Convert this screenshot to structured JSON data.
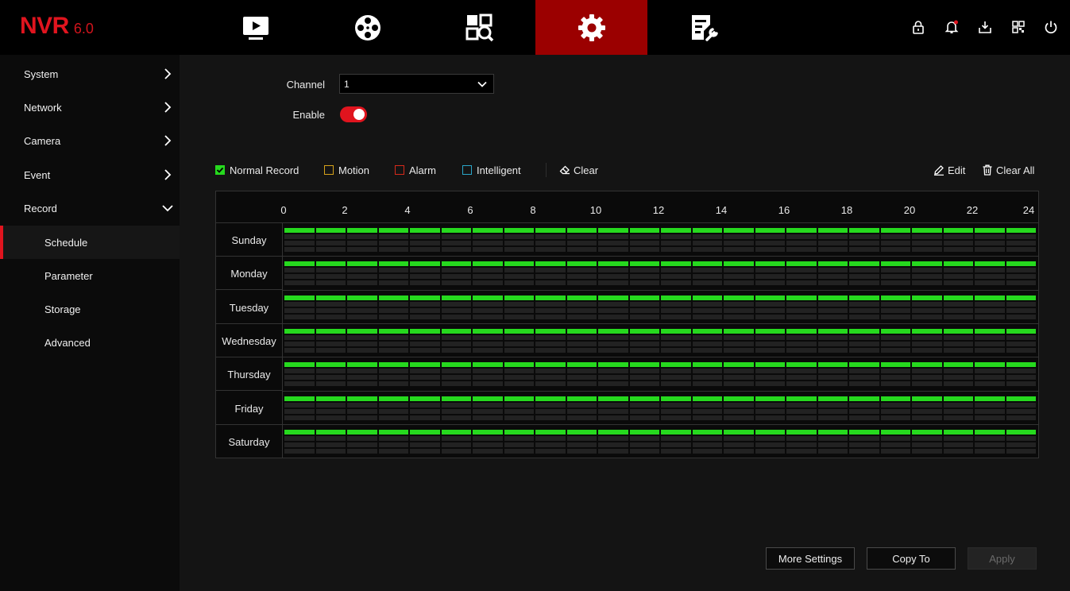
{
  "logo": {
    "main": "NVR",
    "version": "6.0"
  },
  "nav_tabs": [
    {
      "name": "playback-icon",
      "active": false
    },
    {
      "name": "film-reel-icon",
      "active": false
    },
    {
      "name": "search-grid-icon",
      "active": false
    },
    {
      "name": "gear-icon",
      "active": true
    },
    {
      "name": "maintenance-icon",
      "active": false
    }
  ],
  "top_icons": [
    "lock-icon",
    "bell-icon",
    "download-icon",
    "qr-code-icon",
    "power-icon"
  ],
  "sidebar": {
    "items": [
      {
        "label": "System",
        "expanded": false
      },
      {
        "label": "Network",
        "expanded": false
      },
      {
        "label": "Camera",
        "expanded": false
      },
      {
        "label": "Event",
        "expanded": false
      },
      {
        "label": "Record",
        "expanded": true
      }
    ],
    "sub_items": [
      {
        "label": "Schedule",
        "active": true
      },
      {
        "label": "Parameter",
        "active": false
      },
      {
        "label": "Storage",
        "active": false
      },
      {
        "label": "Advanced",
        "active": false
      }
    ]
  },
  "form": {
    "channel_label": "Channel",
    "channel_value": "1",
    "enable_label": "Enable",
    "enable_on": true
  },
  "legend": [
    {
      "label": "Normal Record",
      "color": "#26d91e",
      "checked": true
    },
    {
      "label": "Motion",
      "color": "#d6a21a",
      "checked": false
    },
    {
      "label": "Alarm",
      "color": "#d62a1a",
      "checked": false
    },
    {
      "label": "Intelligent",
      "color": "#2aa6c8",
      "checked": false
    }
  ],
  "tools": {
    "clear": "Clear",
    "edit": "Edit",
    "clear_all": "Clear All"
  },
  "schedule": {
    "hour_labels": [
      "0",
      "2",
      "4",
      "6",
      "8",
      "10",
      "12",
      "14",
      "16",
      "18",
      "20",
      "22",
      "24"
    ],
    "days": [
      "Sunday",
      "Monday",
      "Tuesday",
      "Wednesday",
      "Thursday",
      "Friday",
      "Saturday"
    ],
    "normal_record_hours": [
      0,
      24
    ],
    "segments_per_day": 24,
    "empty_color": "#222222"
  },
  "buttons": {
    "more_settings": "More Settings",
    "copy_to": "Copy To",
    "apply": "Apply"
  }
}
